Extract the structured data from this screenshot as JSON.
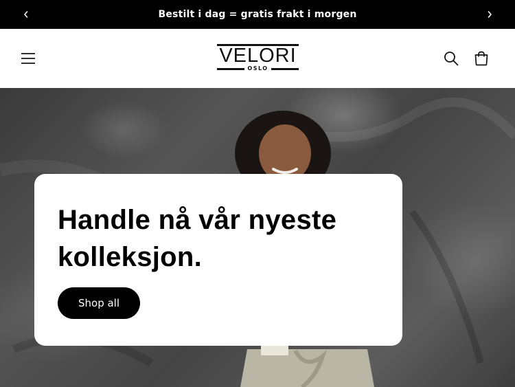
{
  "announcement": {
    "message": "Bestilt i dag = gratis frakt i morgen",
    "prev_icon": "chevron-left-icon",
    "next_icon": "chevron-right-icon"
  },
  "header": {
    "logo": {
      "word": "VELORI",
      "sub": "OSLO"
    },
    "menu_icon": "hamburger-icon",
    "search_icon": "search-icon",
    "cart_icon": "cart-icon"
  },
  "hero": {
    "heading": "Handle nå vår nyeste kolleksjon.",
    "button_label": "Shop all"
  },
  "colors": {
    "announcement_bg": "#000000",
    "announcement_text": "#ffffff",
    "button_bg": "#000000",
    "button_text": "#ffffff",
    "card_bg": "#ffffff"
  }
}
